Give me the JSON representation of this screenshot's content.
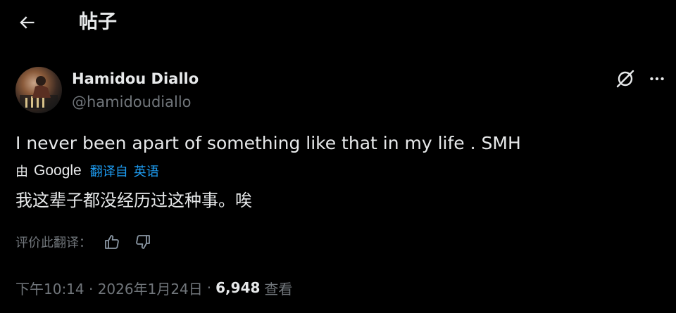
{
  "header": {
    "title": "帖子"
  },
  "post": {
    "author": {
      "display_name": "Hamidou Diallo",
      "handle": "@hamidoudiallo"
    },
    "text": "I never been apart of something like that in my life . SMH",
    "translation": {
      "by_label": "由",
      "provider": "Google",
      "translated_from_label": "翻译自",
      "source_language": "英语",
      "translated_text": "我这辈子都没经历过这种事。唉",
      "rate_label": "评价此翻译："
    },
    "meta": {
      "timestamp": "下午10:14 · 2026年1月24日",
      "separator": "·",
      "views_count": "6,948",
      "views_label": "查看"
    }
  },
  "icons": {
    "back": "arrow-left-icon",
    "grok": "grok-icon",
    "more": "more-horizontal-icon",
    "thumbs_up": "thumbs-up-icon",
    "thumbs_down": "thumbs-down-icon"
  },
  "colors": {
    "background": "#000000",
    "text_primary": "#e7e9ea",
    "text_secondary": "#71767b",
    "accent": "#1d9bf0"
  }
}
